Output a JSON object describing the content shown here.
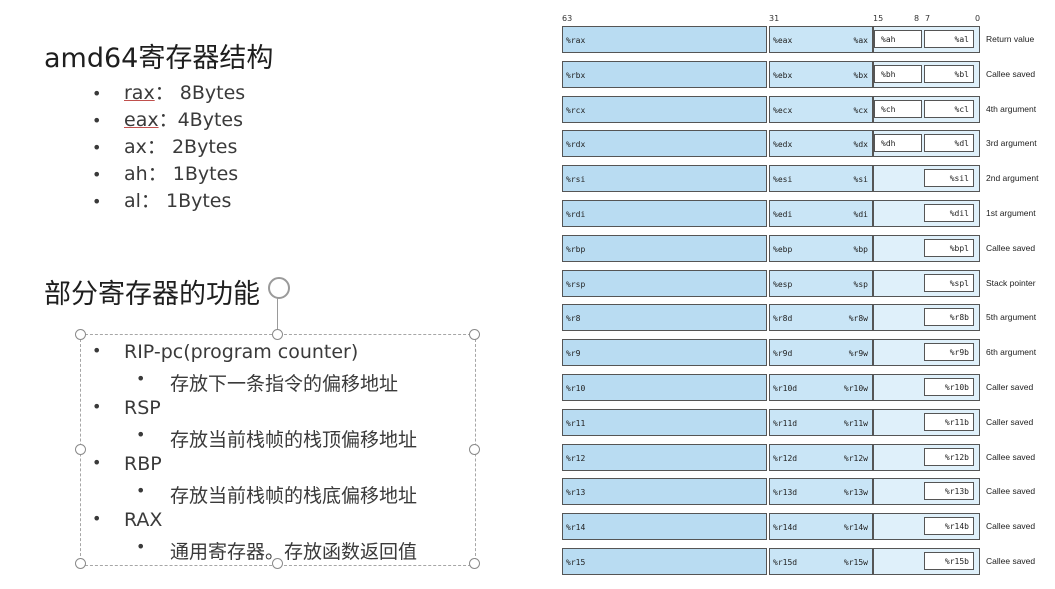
{
  "slide": {
    "title1": "amd64寄存器结构",
    "sizes": [
      {
        "reg": "rax",
        "sep": "：",
        "val": "8Bytes"
      },
      {
        "reg": "eax",
        "sep": "：",
        "val": "4Bytes"
      },
      {
        "reg": "ax",
        "sep": "：",
        "val": "2Bytes"
      },
      {
        "reg": "ah",
        "sep": "：",
        "val": "1Bytes"
      },
      {
        "reg": "al",
        "sep": "：",
        "val": "1Bytes"
      }
    ],
    "title2": "部分寄存器的功能",
    "functions": [
      {
        "level": 1,
        "text": "RIP-pc(program counter)"
      },
      {
        "level": 2,
        "text": "存放下一条指令的偏移地址"
      },
      {
        "level": 1,
        "text": "RSP"
      },
      {
        "level": 2,
        "text": "存放当前栈帧的栈顶偏移地址"
      },
      {
        "level": 1,
        "text": "RBP"
      },
      {
        "level": 2,
        "text": "存放当前栈帧的栈底偏移地址"
      },
      {
        "level": 1,
        "text": "RAX"
      },
      {
        "level": 2,
        "text": "通用寄存器。存放函数返回值"
      }
    ]
  },
  "register_table": {
    "bit_labels": {
      "b63": "63",
      "b31": "31",
      "b15": "15",
      "b8": "8",
      "b7": "7",
      "b0": "0"
    },
    "rows": [
      {
        "r64": "%rax",
        "r32": "%eax",
        "r16": "%ax",
        "r8h": "%ah",
        "r8l": "%al",
        "purpose": "Return value"
      },
      {
        "r64": "%rbx",
        "r32": "%ebx",
        "r16": "%bx",
        "r8h": "%bh",
        "r8l": "%bl",
        "purpose": "Callee saved"
      },
      {
        "r64": "%rcx",
        "r32": "%ecx",
        "r16": "%cx",
        "r8h": "%ch",
        "r8l": "%cl",
        "purpose": "4th argument"
      },
      {
        "r64": "%rdx",
        "r32": "%edx",
        "r16": "%dx",
        "r8h": "%dh",
        "r8l": "%dl",
        "purpose": "3rd argument"
      },
      {
        "r64": "%rsi",
        "r32": "%esi",
        "r16": "%si",
        "r8h": "",
        "r8l": "%sil",
        "purpose": "2nd argument"
      },
      {
        "r64": "%rdi",
        "r32": "%edi",
        "r16": "%di",
        "r8h": "",
        "r8l": "%dil",
        "purpose": "1st argument"
      },
      {
        "r64": "%rbp",
        "r32": "%ebp",
        "r16": "%bp",
        "r8h": "",
        "r8l": "%bpl",
        "purpose": "Callee saved"
      },
      {
        "r64": "%rsp",
        "r32": "%esp",
        "r16": "%sp",
        "r8h": "",
        "r8l": "%spl",
        "purpose": "Stack pointer"
      },
      {
        "r64": "%r8",
        "r32": "%r8d",
        "r16": "%r8w",
        "r8h": "",
        "r8l": "%r8b",
        "purpose": "5th argument"
      },
      {
        "r64": "%r9",
        "r32": "%r9d",
        "r16": "%r9w",
        "r8h": "",
        "r8l": "%r9b",
        "purpose": "6th argument"
      },
      {
        "r64": "%r10",
        "r32": "%r10d",
        "r16": "%r10w",
        "r8h": "",
        "r8l": "%r10b",
        "purpose": "Caller saved"
      },
      {
        "r64": "%r11",
        "r32": "%r11d",
        "r16": "%r11w",
        "r8h": "",
        "r8l": "%r11b",
        "purpose": "Caller saved"
      },
      {
        "r64": "%r12",
        "r32": "%r12d",
        "r16": "%r12w",
        "r8h": "",
        "r8l": "%r12b",
        "purpose": "Callee saved"
      },
      {
        "r64": "%r13",
        "r32": "%r13d",
        "r16": "%r13w",
        "r8h": "",
        "r8l": "%r13b",
        "purpose": "Callee saved"
      },
      {
        "r64": "%r14",
        "r32": "%r14d",
        "r16": "%r14w",
        "r8h": "",
        "r8l": "%r14b",
        "purpose": "Callee saved"
      },
      {
        "r64": "%r15",
        "r32": "%r15d",
        "r16": "%r15w",
        "r8h": "",
        "r8l": "%r15b",
        "purpose": "Callee saved"
      }
    ]
  }
}
